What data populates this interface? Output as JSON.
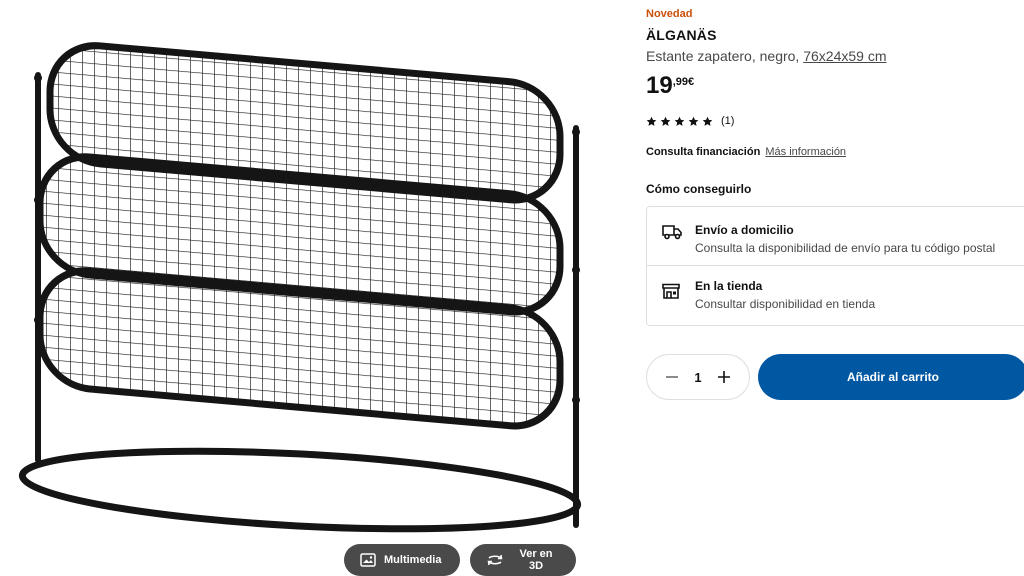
{
  "product": {
    "badge": "Novedad",
    "name": "ÄLGANÄS",
    "description": "Estante zapatero, negro,",
    "dimensions": "76x24x59 cm",
    "price": {
      "integer": "19",
      "decimal": ",99€"
    },
    "rating": {
      "stars": 5,
      "max_stars": 5,
      "count": "(1)"
    },
    "financing": {
      "label": "Consulta financiación",
      "link": "Más información"
    }
  },
  "gallery": {
    "multimedia_label": "Multimedia",
    "view3d_label": "Ver en 3D"
  },
  "fulfillment": {
    "title": "Cómo conseguirlo",
    "options": [
      {
        "icon": "delivery-truck-icon",
        "title": "Envío a domicilio",
        "subtitle": "Consulta la disponibilidad de envío para tu código postal"
      },
      {
        "icon": "store-icon",
        "title": "En la tienda",
        "subtitle": "Consultar disponibilidad en tienda"
      }
    ]
  },
  "purchase": {
    "quantity": "1",
    "add_to_cart_label": "Añadir al carrito"
  },
  "colors": {
    "badge": "#ca5008",
    "primary_button": "#0058a3",
    "pill_bg": "#4a4a4a",
    "text_secondary": "#484848",
    "border": "#dfdfdf"
  }
}
